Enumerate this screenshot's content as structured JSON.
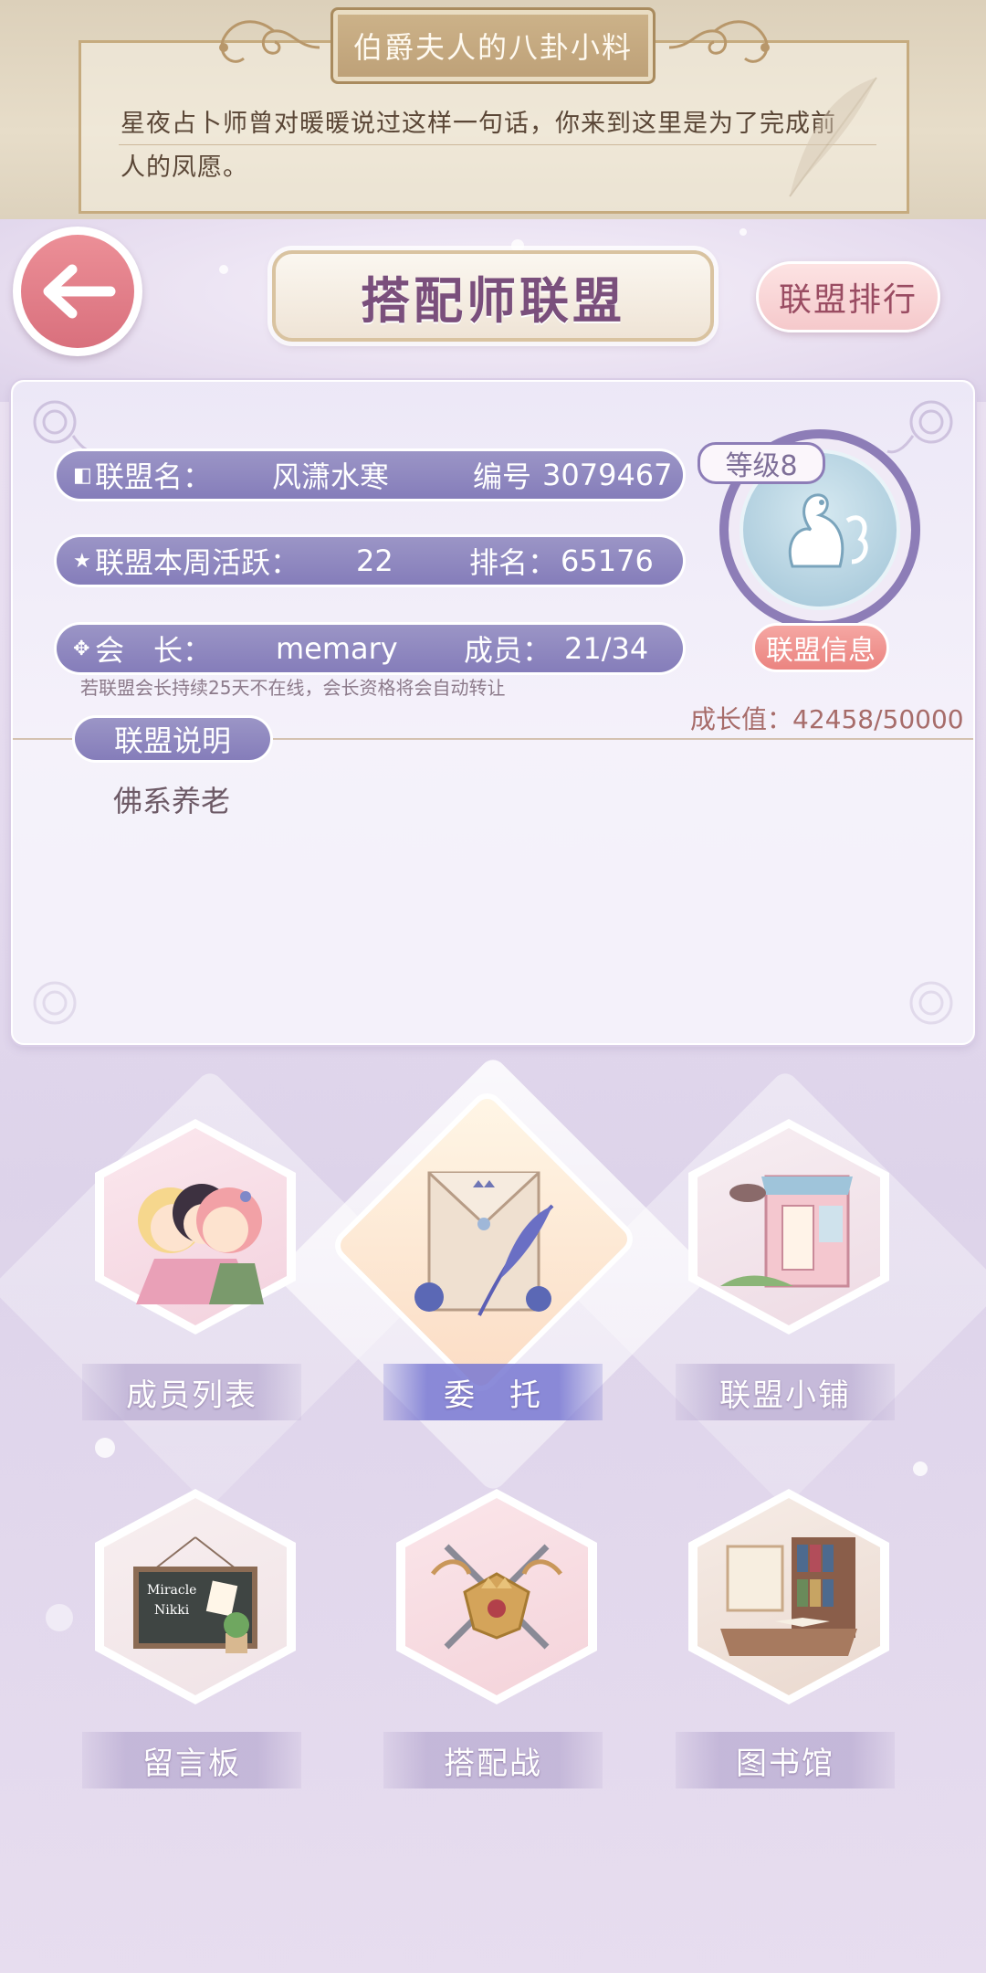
{
  "gossip": {
    "title": "伯爵夫人的八卦小料",
    "line1": "星夜占卜师曾对暖暖说过这样一句话，你来到这里是为了完成前",
    "line2": "人的凤愿。"
  },
  "header": {
    "title": "搭配师联盟",
    "rank_button": "联盟排行"
  },
  "info": {
    "name_label": "联盟名：",
    "name_value": "风潇水寒",
    "id_label": "编号",
    "id_value": "3079467",
    "activity_label": "联盟本周活跃：",
    "activity_value": "22",
    "rank_label": "排名：",
    "rank_value": "65176",
    "leader_label": "会　长：",
    "leader_value": "memary",
    "members_label": "成员：",
    "members_value": "21/34",
    "note": "若联盟会长持续25天不在线，会长资格将会自动转让",
    "level": "等级8",
    "info_button": "联盟信息",
    "growth": "成长值：42458/50000",
    "desc_tab": "联盟说明",
    "desc_text": "佛系养老"
  },
  "menu": [
    {
      "label": "成员列表",
      "icon": "members-icon"
    },
    {
      "label": "委　托",
      "icon": "commission-envelope-icon"
    },
    {
      "label": "联盟小铺",
      "icon": "shop-icon"
    },
    {
      "label": "留言板",
      "icon": "message-board-icon"
    },
    {
      "label": "搭配战",
      "icon": "crossed-swords-icon"
    },
    {
      "label": "图书馆",
      "icon": "library-icon"
    }
  ],
  "colors": {
    "accent_purple": "#857dba",
    "back_button": "#d9707d",
    "title_text": "#7a4f7c",
    "info_button": "#eb8480"
  }
}
